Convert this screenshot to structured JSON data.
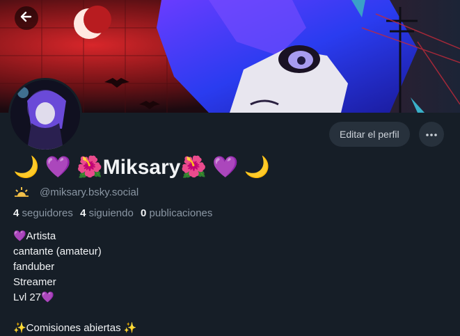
{
  "profile": {
    "display_name": "🌙 💜 🌺Miksary🌺 💜 🌙",
    "handle": "@miksary.bsky.social",
    "handle_emoji": "🌅"
  },
  "actions": {
    "edit_label": "Editar el perfil",
    "more_label": "···"
  },
  "stats": {
    "followers_count": "4",
    "followers_label": "seguidores",
    "following_count": "4",
    "following_label": "siguiendo",
    "posts_count": "0",
    "posts_label": "publicaciones"
  },
  "bio": {
    "line1": "💜Artista",
    "line2": "cantante (amateur)",
    "line3": "fanduber",
    "line4": "Streamer",
    "line5": "Lvl 27💜",
    "line6": "✨Comisiones abiertas ✨"
  },
  "icons": {
    "back": "arrow-left-icon",
    "more": "ellipsis-icon",
    "handle": "sunrise-icon"
  },
  "colors": {
    "background": "#161e27",
    "button_bg": "#27313c",
    "muted_text": "#8a96a3",
    "text": "#f1f3f5"
  }
}
